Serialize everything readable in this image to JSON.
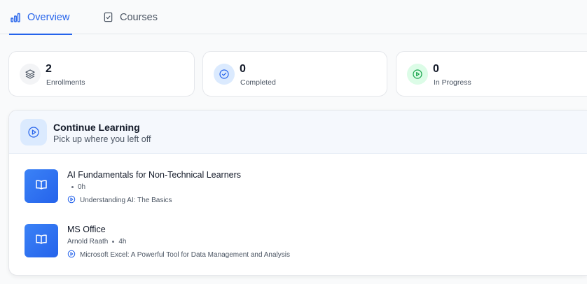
{
  "tabs": [
    {
      "label": "Overview",
      "icon": "bar-chart-icon",
      "active": true
    },
    {
      "label": "Courses",
      "icon": "clipboard-icon",
      "active": false
    }
  ],
  "stats": [
    {
      "value": "2",
      "label": "Enrollments",
      "icon": "layers-icon"
    },
    {
      "value": "0",
      "label": "Completed",
      "icon": "check-circle-icon"
    },
    {
      "value": "0",
      "label": "In Progress",
      "icon": "play-circle-icon"
    }
  ],
  "continue_learning": {
    "title": "Continue Learning",
    "subtitle": "Pick up where you left off",
    "courses": [
      {
        "title": "AI Fundamentals for Non-Technical Learners",
        "instructor": "",
        "duration": "0h",
        "lesson": "Understanding AI: The Basics"
      },
      {
        "title": "MS Office",
        "instructor": "Arnold Raath",
        "duration": "4h",
        "lesson": "Microsoft Excel: A Powerful Tool for Data Management and Analysis"
      }
    ]
  },
  "colors": {
    "accent": "#2563eb",
    "completed_badge": "#dbeafe",
    "progress_badge": "#dcfce7",
    "progress_icon": "#16a34a"
  }
}
